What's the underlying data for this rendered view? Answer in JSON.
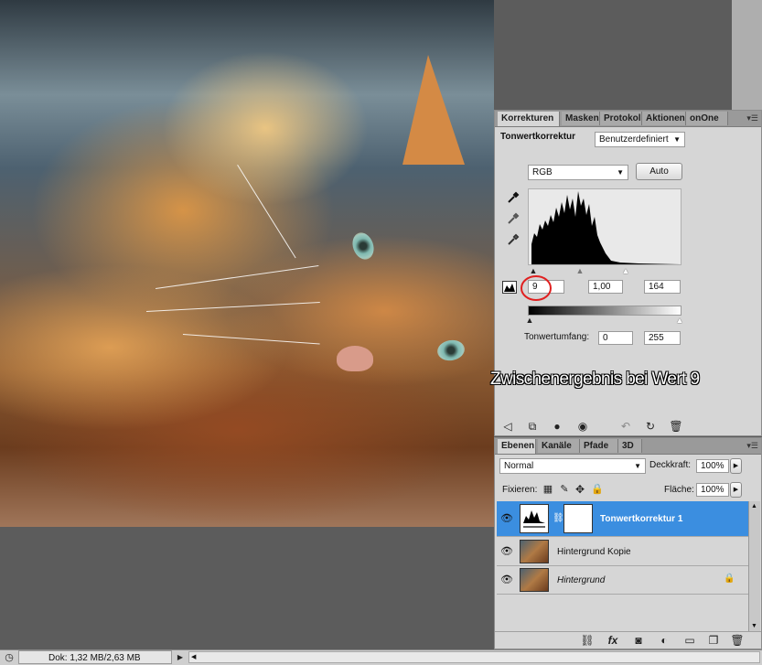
{
  "corrections_panel": {
    "tabs": [
      "Korrekturen",
      "Masken",
      "Protokoll",
      "Aktionen",
      "onOne"
    ],
    "title": "Tonwertkorrektur",
    "preset_value": "Benutzerdefiniert",
    "channel_value": "RGB",
    "auto_button": "Auto",
    "input_black": "9",
    "input_gamma": "1,00",
    "input_white": "164",
    "output_label": "Tonwertumfang:",
    "output_black": "0",
    "output_white": "255",
    "annotation": "Zwischenergebnis bei Wert 9",
    "annotation_color": "#e02020"
  },
  "layers_panel": {
    "tabs": [
      "Ebenen",
      "Kanäle",
      "Pfade",
      "3D"
    ],
    "blend_mode": "Normal",
    "opacity_label": "Deckkraft:",
    "opacity_value": "100%",
    "lock_label": "Fixieren:",
    "fill_label": "Fläche:",
    "fill_value": "100%",
    "layers": [
      {
        "name": "Tonwertkorrektur 1",
        "selected": true
      },
      {
        "name": "Hintergrund Kopie",
        "selected": false
      },
      {
        "name": "Hintergrund",
        "selected": false,
        "locked": true
      }
    ],
    "selection_color": "#3b8ee0"
  },
  "statusbar": {
    "doc_info": "Dok: 1,32 MB/2,63 MB"
  }
}
